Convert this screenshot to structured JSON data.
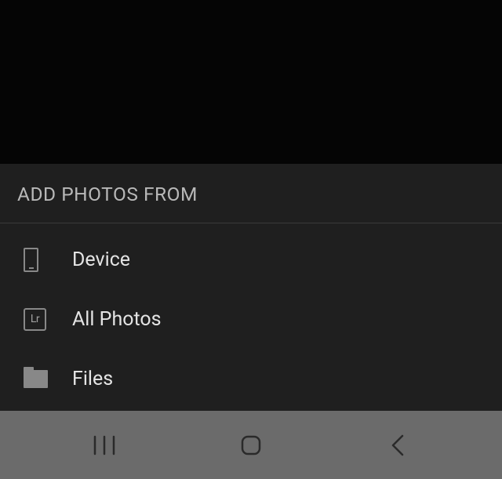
{
  "sheet": {
    "title": "ADD PHOTOS FROM",
    "items": [
      {
        "label": "Device"
      },
      {
        "label": "All Photos",
        "icon_text": "Lr"
      },
      {
        "label": "Files"
      }
    ]
  }
}
